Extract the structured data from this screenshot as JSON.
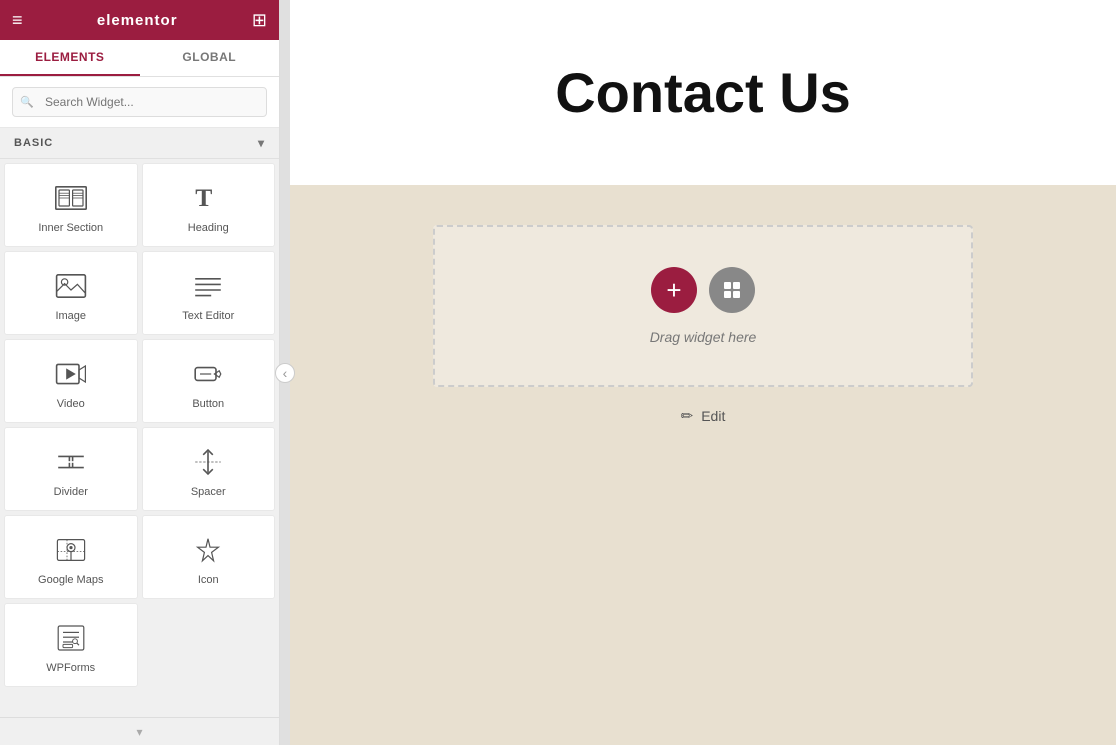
{
  "header": {
    "logo": "elementor",
    "menu_icon": "≡",
    "apps_icon": "⊞"
  },
  "tabs": [
    {
      "id": "elements",
      "label": "ELEMENTS",
      "active": true
    },
    {
      "id": "global",
      "label": "GLOBAL",
      "active": false
    }
  ],
  "search": {
    "placeholder": "Search Widget..."
  },
  "basic_section": {
    "label": "BASIC",
    "collapsed": false
  },
  "widgets": [
    {
      "id": "inner-section",
      "label": "Inner Section",
      "icon_type": "inner-section"
    },
    {
      "id": "heading",
      "label": "Heading",
      "icon_type": "heading"
    },
    {
      "id": "image",
      "label": "Image",
      "icon_type": "image"
    },
    {
      "id": "text-editor",
      "label": "Text Editor",
      "icon_type": "text-editor"
    },
    {
      "id": "video",
      "label": "Video",
      "icon_type": "video"
    },
    {
      "id": "button",
      "label": "Button",
      "icon_type": "button"
    },
    {
      "id": "divider",
      "label": "Divider",
      "icon_type": "divider"
    },
    {
      "id": "spacer",
      "label": "Spacer",
      "icon_type": "spacer"
    },
    {
      "id": "google-maps",
      "label": "Google Maps",
      "icon_type": "google-maps"
    },
    {
      "id": "icon",
      "label": "Icon",
      "icon_type": "icon"
    },
    {
      "id": "wpforms",
      "label": "WPForms",
      "icon_type": "wpforms"
    }
  ],
  "canvas": {
    "page_title": "Contact Us",
    "drop_zone_label": "Drag widget here",
    "add_button_label": "+",
    "edit_label": "Edit"
  },
  "colors": {
    "primary": "#9b1d40",
    "canvas_bg": "#e8e0d0",
    "white": "#ffffff"
  }
}
